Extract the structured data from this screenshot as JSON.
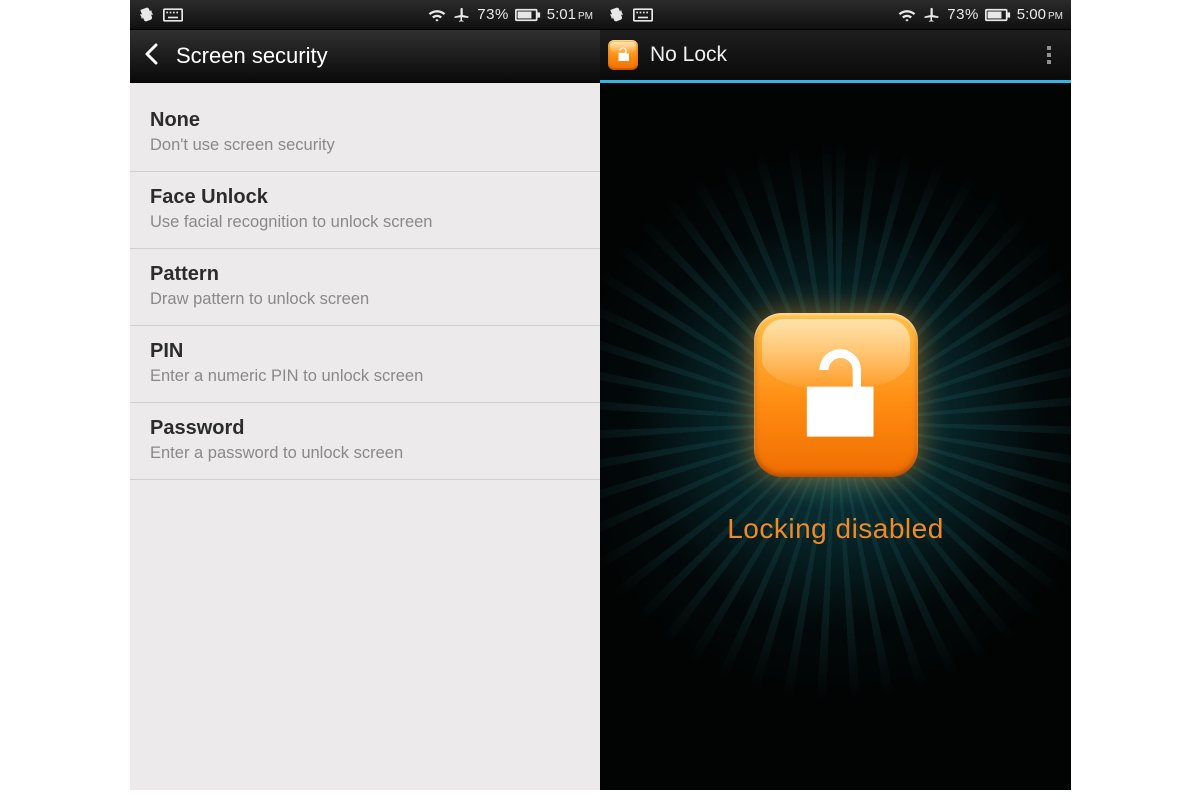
{
  "left": {
    "statusbar": {
      "battery_pct": "73%",
      "time": "5:01",
      "ampm": "PM"
    },
    "appbar": {
      "title": "Screen security"
    },
    "options": [
      {
        "title": "None",
        "subtitle": "Don't use screen security"
      },
      {
        "title": "Face Unlock",
        "subtitle": "Use facial recognition to unlock screen"
      },
      {
        "title": "Pattern",
        "subtitle": "Draw pattern to unlock screen"
      },
      {
        "title": "PIN",
        "subtitle": "Enter a numeric PIN to unlock screen"
      },
      {
        "title": "Password",
        "subtitle": "Enter a password to unlock screen"
      }
    ]
  },
  "right": {
    "statusbar": {
      "battery_pct": "73%",
      "time": "5:00",
      "ampm": "PM"
    },
    "appbar": {
      "title": "No Lock"
    },
    "status_text": "Locking disabled"
  }
}
